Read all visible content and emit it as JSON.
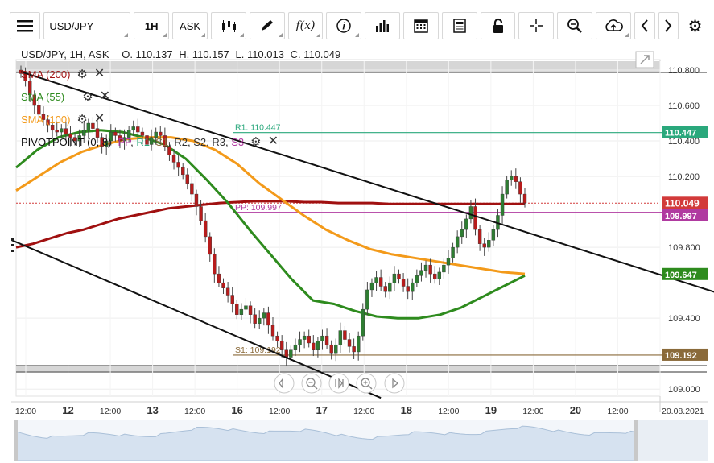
{
  "toolbar": {
    "menu_icon": "hamburger-icon",
    "symbol": "USD/JPY",
    "interval": "1H",
    "price_type": "ASK",
    "buttons": [
      {
        "name": "chart-type-button",
        "icon": "candles-icon"
      },
      {
        "name": "draw-button",
        "icon": "pencil-icon"
      },
      {
        "name": "indicators-button",
        "icon": "fx-icon"
      },
      {
        "name": "info-button",
        "icon": "info-icon"
      },
      {
        "name": "volume-button",
        "icon": "bars-icon"
      },
      {
        "name": "calendar-button",
        "icon": "calendar-icon"
      },
      {
        "name": "news-button",
        "icon": "document-icon"
      },
      {
        "name": "lock-button",
        "icon": "lock-icon"
      },
      {
        "name": "crosshair-button",
        "icon": "crosshair-icon"
      },
      {
        "name": "zoom-button",
        "icon": "magnifier-icon"
      },
      {
        "name": "cloud-button",
        "icon": "cloud-upload-icon"
      },
      {
        "name": "prev-button",
        "icon": "chevron-left-icon"
      },
      {
        "name": "next-button",
        "icon": "chevron-right-icon"
      },
      {
        "name": "settings-button",
        "icon": "gear-icon"
      }
    ]
  },
  "header": {
    "pair": "USD/JPY, 1H, ASK",
    "open": "O. 110.137",
    "high": "H. 110.157",
    "low": "L. 110.013",
    "close": "C. 110.049"
  },
  "indicators": [
    {
      "label": "SMA (200)",
      "color": "#a01010"
    },
    {
      "label": "SMA (55)",
      "color": "#2e8b1e"
    },
    {
      "label": "SMA (100)",
      "color": "#f39a1a"
    },
    {
      "label": "PIVOTPOINT (0, 8)",
      "color": "#111111"
    }
  ],
  "pivot_keys": [
    {
      "label": "PP",
      "color": "#b03aa0"
    },
    {
      "label": "R1",
      "color": "#2aa87c"
    },
    {
      "label": "S1",
      "color": "#8a6a3a"
    },
    {
      "label": "R2",
      "color": "#333333"
    },
    {
      "label": "S2",
      "color": "#333333"
    },
    {
      "label": "R3",
      "color": "#333333"
    },
    {
      "label": "S3",
      "color": "#b03aa0"
    }
  ],
  "chart_data": {
    "type": "candlestick",
    "ylim": [
      108.96,
      110.85
    ],
    "y_ticks": [
      110.8,
      110.6,
      110.4,
      110.2,
      109.8,
      109.4,
      109.0
    ],
    "y_tick_labels": [
      "110.800",
      "110.600",
      "110.400",
      "110.200",
      "109.800",
      "109.400",
      "109.000"
    ],
    "x_tick_labels": [
      {
        "label": "12:00",
        "bold": false
      },
      {
        "label": "12",
        "bold": true
      },
      {
        "label": "12:00",
        "bold": false
      },
      {
        "label": "13",
        "bold": true
      },
      {
        "label": "12:00",
        "bold": false
      },
      {
        "label": "16",
        "bold": true
      },
      {
        "label": "12:00",
        "bold": false
      },
      {
        "label": "17",
        "bold": true
      },
      {
        "label": "12:00",
        "bold": false
      },
      {
        "label": "18",
        "bold": true
      },
      {
        "label": "12:00",
        "bold": false
      },
      {
        "label": "19",
        "bold": true
      },
      {
        "label": "12:00",
        "bold": false
      },
      {
        "label": "20",
        "bold": true
      },
      {
        "label": "12:00",
        "bold": false
      },
      {
        "label": "20.08.2021",
        "bold": false
      }
    ],
    "close_series": [
      110.78,
      110.74,
      110.66,
      110.6,
      110.55,
      110.52,
      110.49,
      110.46,
      110.45,
      110.47,
      110.44,
      110.42,
      110.4,
      110.43,
      110.46,
      110.5,
      110.47,
      110.42,
      110.37,
      110.4,
      110.45,
      110.43,
      110.4,
      110.42,
      110.46,
      110.48,
      110.45,
      110.43,
      110.38,
      110.42,
      110.45,
      110.43,
      110.37,
      110.32,
      110.28,
      110.25,
      110.21,
      110.16,
      110.1,
      110.03,
      109.95,
      109.86,
      109.76,
      109.65,
      109.6,
      109.57,
      109.53,
      109.48,
      109.42,
      109.45,
      109.47,
      109.42,
      109.37,
      109.4,
      109.43,
      109.36,
      109.3,
      109.27,
      109.22,
      109.18,
      109.22,
      109.25,
      109.28,
      109.3,
      109.26,
      109.22,
      109.27,
      109.3,
      109.25,
      109.2,
      109.25,
      109.33,
      109.28,
      109.24,
      109.21,
      109.3,
      109.45,
      109.56,
      109.6,
      109.63,
      109.58,
      109.55,
      109.6,
      109.65,
      109.62,
      109.58,
      109.55,
      109.6,
      109.64,
      109.67,
      109.7,
      109.65,
      109.62,
      109.66,
      109.7,
      109.74,
      109.8,
      109.86,
      109.9,
      109.96,
      110.03,
      109.9,
      109.82,
      109.8,
      109.84,
      109.9,
      109.98,
      110.1,
      110.18,
      110.2,
      110.17,
      110.1,
      110.05
    ],
    "series": [
      {
        "name": "SMA (200)",
        "values": [
          109.8,
          109.82,
          109.85,
          109.88,
          109.9,
          109.93,
          109.96,
          109.98,
          110.0,
          110.02,
          110.03,
          110.04,
          110.05,
          110.055,
          110.06,
          110.06,
          110.06,
          110.055,
          110.055,
          110.05,
          110.05,
          110.05,
          110.045,
          110.045,
          110.045,
          110.045,
          110.045,
          110.045,
          110.045,
          110.045,
          110.045
        ]
      },
      {
        "name": "SMA (55)",
        "values": [
          110.25,
          110.35,
          110.42,
          110.45,
          110.46,
          110.45,
          110.42,
          110.38,
          110.3,
          110.18,
          110.05,
          109.9,
          109.76,
          109.62,
          109.5,
          109.48,
          109.44,
          109.41,
          109.4,
          109.4,
          109.42,
          109.46,
          109.52,
          109.58,
          109.64
        ]
      },
      {
        "name": "SMA (100)",
        "values": [
          110.12,
          110.2,
          110.28,
          110.34,
          110.38,
          110.41,
          110.42,
          110.42,
          110.4,
          110.35,
          110.27,
          110.16,
          110.07,
          109.98,
          109.9,
          109.84,
          109.79,
          109.76,
          109.74,
          109.72,
          109.7,
          109.68,
          109.66,
          109.65
        ]
      }
    ],
    "levels": [
      {
        "name": "R1",
        "label": "R1: 110.447",
        "value": 110.447,
        "color": "#2aa87c"
      },
      {
        "name": "PP",
        "label": "PP: 109.997",
        "value": 109.997,
        "color": "#b03aa0"
      },
      {
        "name": "S1",
        "label": "S1: 109.192",
        "value": 109.192,
        "color": "#8a6a3a"
      }
    ],
    "price_labels": [
      {
        "value": "110.447",
        "bg": "#2aa87c"
      },
      {
        "value": "110.049",
        "bg": "#d23a3a"
      },
      {
        "value": "109.997",
        "bg": "#b03aa0"
      },
      {
        "value": "109.647",
        "bg": "#2e8b1e"
      },
      {
        "value": "109.192",
        "bg": "#8a6a3a"
      }
    ],
    "last_price": 110.049,
    "trendlines": [
      {
        "from": [
          0,
          110.79
        ],
        "to": [
          175,
          109.38
        ]
      },
      {
        "from": [
          -2,
          109.84
        ],
        "to": [
          80,
          108.95
        ]
      }
    ],
    "navigator_buttons": [
      "chevron-left-icon",
      "zoom-out-icon",
      "reset-icon",
      "zoom-in-icon",
      "chevron-right-icon"
    ]
  }
}
